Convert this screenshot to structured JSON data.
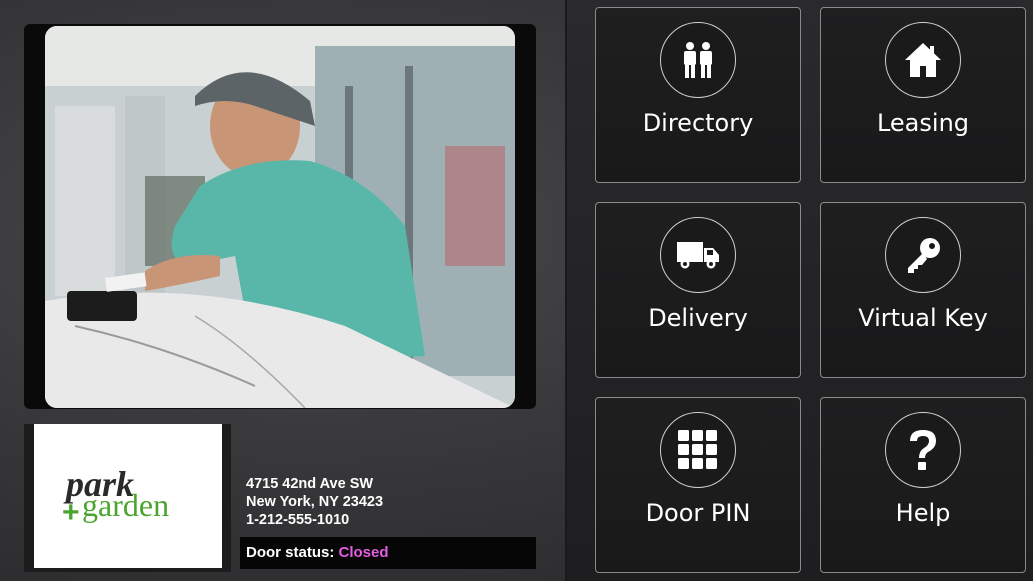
{
  "building": {
    "address_line1": "4715 42nd Ave SW",
    "address_line2": "New York, NY 23423",
    "phone": "1-212-555-1010",
    "logo_word_top": "park",
    "logo_word_bottom": "garden",
    "logo_plus": "+"
  },
  "door": {
    "status_label": "Door status:",
    "status_value": "Closed",
    "status_color": "#e35ee0"
  },
  "menu": {
    "items": [
      {
        "label": "Directory",
        "icon": "people-icon"
      },
      {
        "label": "Leasing",
        "icon": "home-icon"
      },
      {
        "label": "Delivery",
        "icon": "truck-icon"
      },
      {
        "label": "Virtual Key",
        "icon": "key-icon"
      },
      {
        "label": "Door PIN",
        "icon": "keypad-icon"
      },
      {
        "label": "Help",
        "icon": "question-icon"
      }
    ]
  },
  "colors": {
    "logo_green": "#4aa52e",
    "logo_dark": "#2a2a2a"
  }
}
